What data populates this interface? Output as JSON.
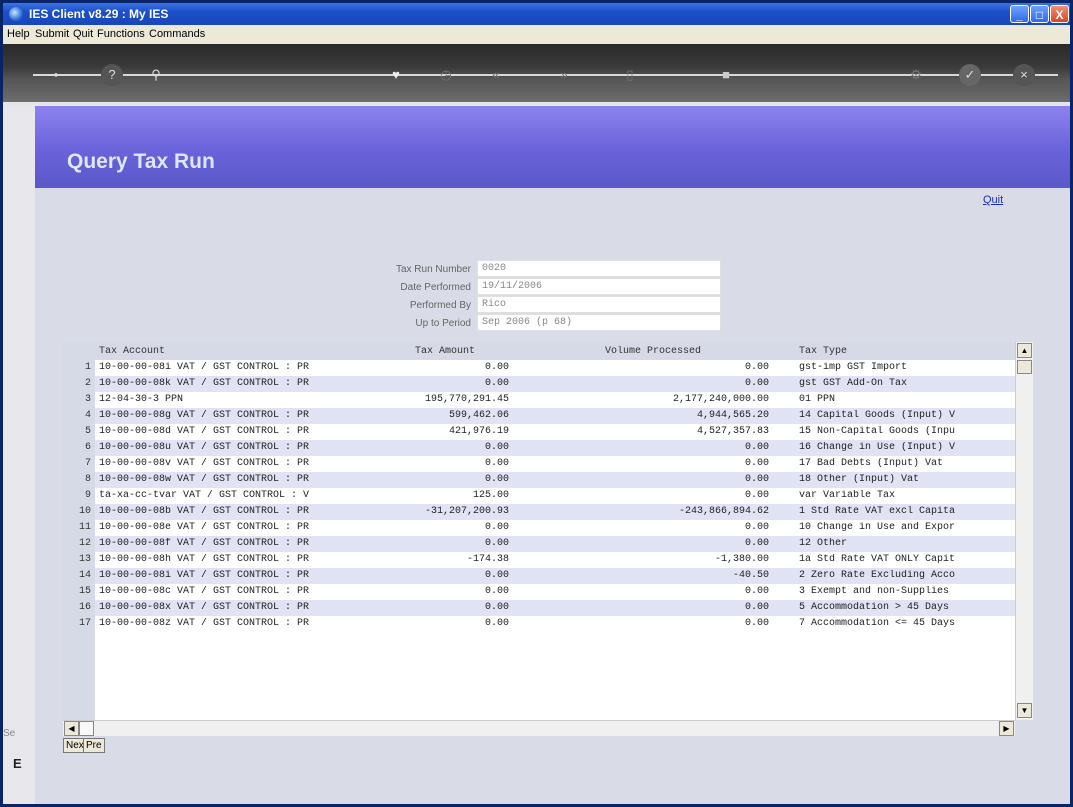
{
  "window": {
    "title": "IES Client v8.29 : My IES",
    "minimize": "_",
    "maximize": "□",
    "close": "X"
  },
  "menu": [
    "Help",
    "Submit",
    "Quit",
    "Functions",
    "Commands"
  ],
  "toolbar_icons": [
    "back-key-icon",
    "help-icon",
    "search-icon",
    "favorite-heart-icon",
    "clock-icon",
    "previous-icon",
    "next-icon",
    "edit-icon",
    "stop-icon",
    "settings-icon",
    "ok-check-icon",
    "close-icon"
  ],
  "page": {
    "heading": "Query Tax Run",
    "quit_link": "Quit"
  },
  "form": {
    "tax_run_number_label": "Tax Run Number",
    "tax_run_number": "0020",
    "date_performed_label": "Date Performed",
    "date_performed": "19/11/2006",
    "performed_by_label": "Performed By",
    "performed_by": "Rico",
    "up_to_period_label": "Up to Period",
    "up_to_period": "Sep 2006 (p 68)"
  },
  "table": {
    "columns": [
      "Tax Account",
      "Tax Amount",
      "Volume Processed",
      "Tax Type"
    ],
    "rows": [
      {
        "n": "1",
        "account": "10-00-00-08i VAT / GST CONTROL : PR",
        "amount": "0.00",
        "volume": "0.00",
        "type": "gst-imp GST Import"
      },
      {
        "n": "2",
        "account": "10-00-00-08k VAT / GST CONTROL : PR",
        "amount": "0.00",
        "volume": "0.00",
        "type": "gst GST Add-On Tax"
      },
      {
        "n": "3",
        "account": "12-04-30-3 PPN",
        "amount": "195,770,291.45",
        "volume": "2,177,240,000.00",
        "type": "01 PPN"
      },
      {
        "n": "4",
        "account": "10-00-00-08g VAT / GST CONTROL : PR",
        "amount": "599,462.06",
        "volume": "4,944,565.20",
        "type": "14 Capital Goods (Input) V"
      },
      {
        "n": "5",
        "account": "10-00-00-08d VAT / GST CONTROL : PR",
        "amount": "421,976.19",
        "volume": "4,527,357.83",
        "type": "15 Non-Capital Goods (Inpu"
      },
      {
        "n": "6",
        "account": "10-00-00-08u VAT / GST CONTROL : PR",
        "amount": "0.00",
        "volume": "0.00",
        "type": "16 Change in Use (Input) V"
      },
      {
        "n": "7",
        "account": "10-00-00-08v VAT / GST CONTROL : PR",
        "amount": "0.00",
        "volume": "0.00",
        "type": "17 Bad Debts (Input) Vat"
      },
      {
        "n": "8",
        "account": "10-00-00-08w VAT / GST CONTROL : PR",
        "amount": "0.00",
        "volume": "0.00",
        "type": "18 Other (Input) Vat"
      },
      {
        "n": "9",
        "account": "ta-xa-cc-tvar VAT / GST CONTROL : V",
        "amount": "125.00",
        "volume": "0.00",
        "type": "var Variable Tax"
      },
      {
        "n": "10",
        "account": "10-00-00-08b VAT / GST CONTROL : PR",
        "amount": "-31,207,200.93",
        "volume": "-243,866,894.62",
        "type": "1 Std Rate VAT excl Capita"
      },
      {
        "n": "11",
        "account": "10-00-00-08e VAT / GST CONTROL : PR",
        "amount": "0.00",
        "volume": "0.00",
        "type": "10 Change in Use and Expor"
      },
      {
        "n": "12",
        "account": "10-00-00-08f VAT / GST CONTROL : PR",
        "amount": "0.00",
        "volume": "0.00",
        "type": "12 Other"
      },
      {
        "n": "13",
        "account": "10-00-00-08h VAT / GST CONTROL : PR",
        "amount": "-174.38",
        "volume": "-1,380.00",
        "type": "1a Std Rate VAT ONLY Capit"
      },
      {
        "n": "14",
        "account": "10-00-00-08i VAT / GST CONTROL : PR",
        "amount": "0.00",
        "volume": "-40.50",
        "type": "2 Zero Rate Excluding Acco"
      },
      {
        "n": "15",
        "account": "10-00-00-08c VAT / GST CONTROL : PR",
        "amount": "0.00",
        "volume": "0.00",
        "type": "3 Exempt and non-Supplies"
      },
      {
        "n": "16",
        "account": "10-00-00-08x VAT / GST CONTROL : PR",
        "amount": "0.00",
        "volume": "0.00",
        "type": "5 Accommodation > 45 Days"
      },
      {
        "n": "17",
        "account": "10-00-00-08z VAT / GST CONTROL : PR",
        "amount": "0.00",
        "volume": "0.00",
        "type": "7 Accommodation <= 45 Days"
      }
    ]
  },
  "nav": {
    "next": "Nex",
    "prev": "Pre"
  },
  "side_fragments": {
    "top": "Se",
    "bottom": "E"
  }
}
